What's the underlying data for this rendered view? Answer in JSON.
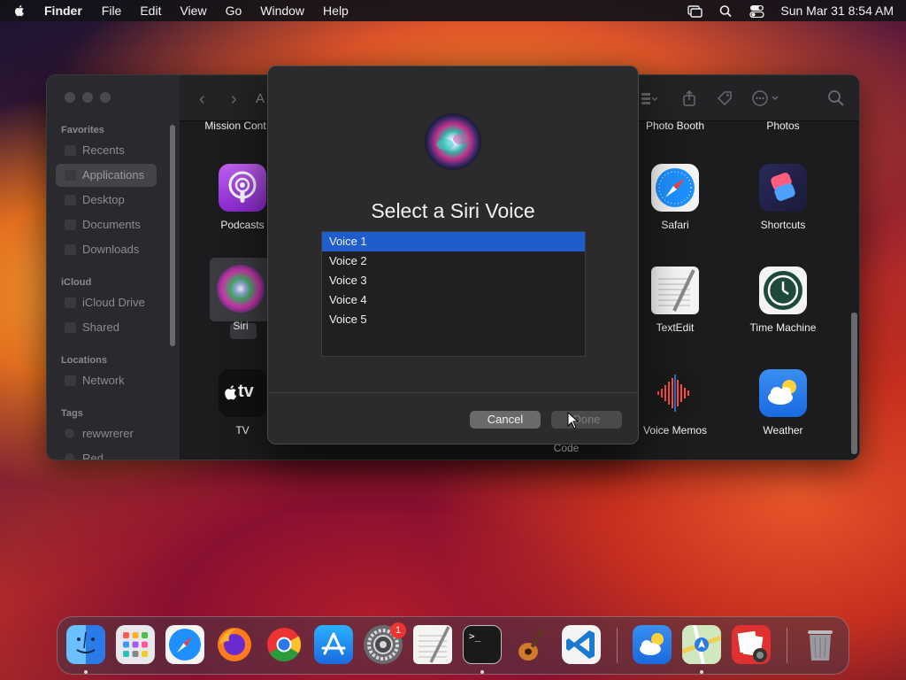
{
  "menubar": {
    "app_name": "Finder",
    "items": [
      "File",
      "Edit",
      "View",
      "Go",
      "Window",
      "Help"
    ],
    "clock": "Sun Mar 31  8:54 AM"
  },
  "finder": {
    "sidebar": {
      "favorites_label": "Favorites",
      "favorites": [
        "Recents",
        "Applications",
        "Desktop",
        "Documents",
        "Downloads"
      ],
      "icloud_label": "iCloud",
      "icloud": [
        "iCloud Drive",
        "Shared"
      ],
      "locations_label": "Locations",
      "locations": [
        "Network"
      ],
      "tags_label": "Tags",
      "tags": [
        "rewwrerer",
        "Red"
      ]
    },
    "path_fragment": "A",
    "apps_left": {
      "top_label": "Mission Cont",
      "podcasts": "Podcasts",
      "siri": "Siri",
      "tv": "TV",
      "tv_icon_text": "tv"
    },
    "apps_right": {
      "top_labels": [
        "Photo Booth",
        "Photos"
      ],
      "row1": [
        "Safari",
        "Shortcuts"
      ],
      "row2": [
        "TextEdit",
        "Time Machine"
      ],
      "row3": [
        "Voice Memos",
        "Weather"
      ]
    },
    "partial_label": "Code"
  },
  "dialog": {
    "title": "Select a Siri Voice",
    "voices": [
      "Voice 1",
      "Voice 2",
      "Voice 3",
      "Voice 4",
      "Voice 5"
    ],
    "selected_index": 0,
    "cancel_label": "Cancel",
    "done_label": "Done"
  },
  "dock": {
    "apps": [
      "Finder",
      "Launchpad",
      "Safari",
      "Firefox",
      "Chrome",
      "App Store",
      "System Settings",
      "TextEdit",
      "Terminal",
      "GarageBand",
      "Visual Studio Code",
      "Weather",
      "Maps",
      "Photo Booth",
      "Trash"
    ],
    "settings_badge": "1",
    "terminal_prompt": ">_"
  },
  "colors": {
    "selection_blue": "#1f5ccc",
    "badge_red": "#e33333"
  }
}
